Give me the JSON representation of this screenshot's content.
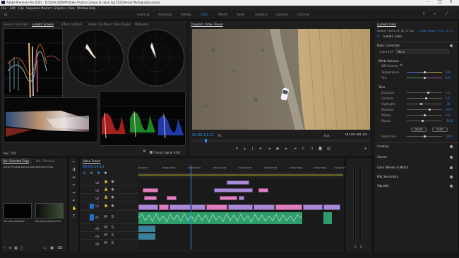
{
  "app": {
    "title": "Adobe Premiere Pro 2021 - D:\\DUACADEMY\\Video Pratica Campo di colori log 2021\\Aerial Photography.prproj"
  },
  "menu": [
    "File",
    "Edit",
    "Clip",
    "Sequence",
    "Markers",
    "Graphics",
    "View",
    "Window",
    "Help"
  ],
  "workspaces": [
    "Learning",
    "Assembly",
    "Editing",
    "Color",
    "Effects",
    "Audio",
    "Graphics",
    "Captions",
    "Libraries"
  ],
  "scopes": {
    "tabs": [
      "Source: (no clips)",
      "Lumetri Scopes",
      "Effect Controls",
      "Audio Clip Mixer: Video Teaser",
      "Metadata"
    ],
    "clamp_label": "Clamp Signal",
    "bit_label": "8 Bit"
  },
  "program": {
    "title": "Program: Video Teaser",
    "timecode": "00:00:14:12",
    "fit": "Fit",
    "quality": "Full",
    "duration": "00:00:40:10"
  },
  "lumetri": {
    "title": "Lumetri Color",
    "source_label": "Source * 2021_07_02_17_44...",
    "seq_label": "Video Teaser * 2021_07_0...",
    "fx_label": "fx",
    "fx_name": "Lumetri Color",
    "basic": "Basic Correction",
    "input_lut_label": "Input LUT",
    "input_lut_value": "None",
    "white_balance": "White Balance",
    "wb_selector": "WB Selector",
    "tone": "Tone",
    "sliders": [
      {
        "name": "Temperature",
        "value": "0.0",
        "fill": 0.5
      },
      {
        "name": "Tint",
        "value": "0.0",
        "fill": 0.5
      },
      {
        "name": "Exposure",
        "value": "1.1",
        "fill": 0.6
      },
      {
        "name": "Contrast",
        "value": "5.0",
        "fill": 0.53
      },
      {
        "name": "Highlights",
        "value": "-30",
        "fill": 0.38
      },
      {
        "name": "Shadows",
        "value": "28.0",
        "fill": 0.62
      },
      {
        "name": "Whites",
        "value": "0.0",
        "fill": 0.5
      },
      {
        "name": "Blacks",
        "value": "-16.0",
        "fill": 0.42
      },
      {
        "name": "Saturation",
        "value": "100.0",
        "fill": 0.5
      }
    ],
    "reset": "Reset",
    "auto": "Auto",
    "sections": [
      "Creative",
      "Curves",
      "Color Wheels & Match",
      "HSL Secondary",
      "Vignette"
    ]
  },
  "project": {
    "tabs": [
      "Bin: Selected Clips",
      "Bin: Timeline"
    ],
    "path": "Aerial Photography.prproj\\Selected Clips",
    "items": [
      "1st Long Big Reel",
      "Sky Jump Aerial 2021"
    ],
    "item_count": "14 Items"
  },
  "timeline": {
    "tab": "Video Teaser",
    "timecode": "00:00:14:12",
    "ruler": [
      "00:00:00",
      "00:00:05:00",
      "00:00:10:00",
      "00:00:15:00",
      "00:00:20:00",
      "00:00:25:00",
      "00:00:30:00",
      "00:00:35:00",
      "00:00:40:00"
    ],
    "tracks": [
      "V4",
      "V3",
      "V2",
      "V1",
      "A1",
      "A2",
      "A3",
      "A4"
    ]
  },
  "colors": {
    "accent": "#2d8ceb",
    "clip_purple": "#a98ad6",
    "clip_pink": "#e17fc0",
    "audio_green": "#2f9c6c"
  }
}
